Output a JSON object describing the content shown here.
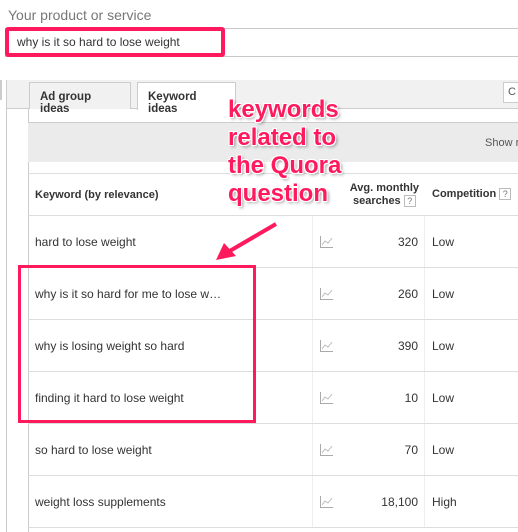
{
  "search": {
    "label": "Your product or service",
    "value": "why is it so hard to lose weight"
  },
  "tabs": [
    {
      "label": "Ad group ideas",
      "active": false
    },
    {
      "label": "Keyword ideas",
      "active": true
    }
  ],
  "top_right_button": "C",
  "toolbar": {
    "show_more": "Show r"
  },
  "table": {
    "headers": {
      "keyword": "Keyword (by relevance)",
      "searches_line1": "Avg. monthly",
      "searches_line2": "searches",
      "competition": "Competition",
      "help": "?"
    },
    "rows": [
      {
        "keyword": "hard to lose weight",
        "searches": "320",
        "competition": "Low"
      },
      {
        "keyword": "why is it so hard for me to lose w…",
        "searches": "260",
        "competition": "Low"
      },
      {
        "keyword": "why is losing weight so hard",
        "searches": "390",
        "competition": "Low"
      },
      {
        "keyword": "finding it hard to lose weight",
        "searches": "10",
        "competition": "Low"
      },
      {
        "keyword": "so hard to lose weight",
        "searches": "70",
        "competition": "Low"
      },
      {
        "keyword": "weight loss supplements",
        "searches": "18,100",
        "competition": "High"
      }
    ]
  },
  "annotation": {
    "lines": [
      "keywords",
      "related to",
      "the Quora",
      "question"
    ],
    "color": "#ff1a5e"
  }
}
